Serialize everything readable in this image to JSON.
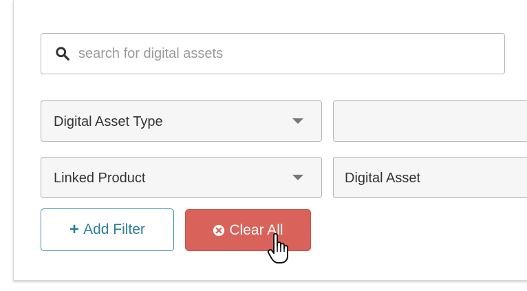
{
  "search": {
    "placeholder": "search for digital assets",
    "icon": "search-icon"
  },
  "filters": [
    {
      "field": "Digital Asset Type",
      "value": ""
    },
    {
      "field": "Linked Product",
      "value": "Digital Asset"
    }
  ],
  "actions": {
    "add_filter_label": "Add Filter",
    "clear_all_label": "Clear All"
  },
  "colors": {
    "add_filter_border": "#3a8fa8",
    "clear_all_bg": "#d9635a",
    "field_border": "#b5b5b5"
  }
}
